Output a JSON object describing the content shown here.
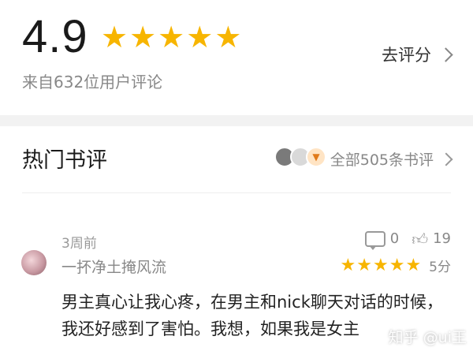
{
  "rating": {
    "score": "4.9",
    "stars": 5,
    "rate_label": "去评分",
    "count_text": "来自632位用户评论"
  },
  "hot_reviews": {
    "title": "热门书评",
    "all_label": "全部505条书评"
  },
  "review": {
    "time": "3周前",
    "username": "一抔净土掩风流",
    "comment_count": "0",
    "like_count": "19",
    "stars": 5,
    "score_label": "5分",
    "text": "男主真心让我心疼，在男主和nick聊天对话的时候，我还好感到了害怕。我想，如果我是女主"
  },
  "watermark": "知乎 @ui王",
  "colors": {
    "star": "#f7b500",
    "muted": "#888888",
    "band": "#f2f2f2"
  }
}
